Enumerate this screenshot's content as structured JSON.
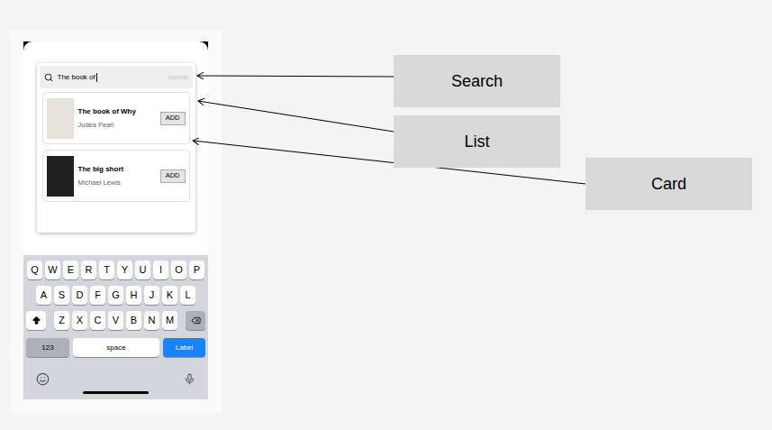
{
  "search": {
    "value": "The book of",
    "action": "cancel"
  },
  "results": [
    {
      "title": "The book of Why",
      "author": "Judea Pearl",
      "button": "ADD",
      "cover": "#e8e3da"
    },
    {
      "title": "The big short",
      "author": "Michael Lewis",
      "button": "ADD",
      "cover": "#1e2120"
    }
  ],
  "keyboard": {
    "rows": [
      [
        "Q",
        "W",
        "E",
        "R",
        "T",
        "Y",
        "U",
        "I",
        "O",
        "P"
      ],
      [
        "A",
        "S",
        "D",
        "F",
        "G",
        "H",
        "J",
        "K",
        "L"
      ],
      [
        "Z",
        "X",
        "C",
        "V",
        "B",
        "N",
        "M"
      ]
    ],
    "numbers": "123",
    "space": "space",
    "return": "Label"
  },
  "annotations": [
    {
      "label": "Search"
    },
    {
      "label": "List"
    },
    {
      "label": "Card"
    }
  ]
}
